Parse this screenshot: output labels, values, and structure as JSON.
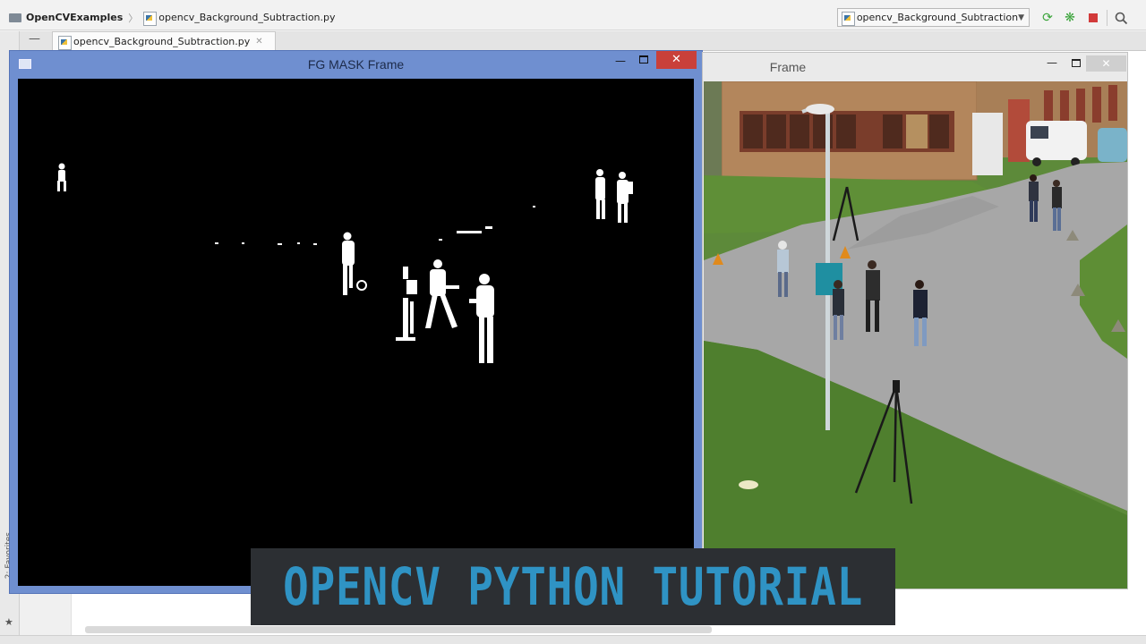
{
  "navbar": {
    "project": "OpenCVExamples",
    "file": "opencv_Background_Subtraction.py",
    "run_config": "opencv_Background_Subtraction",
    "icons": [
      "folder-icon",
      "python-file-icon",
      "rerun-icon",
      "debug-icon",
      "stop-icon",
      "search-icon"
    ]
  },
  "tabs": [
    {
      "label": "opencv_Background_Subtraction.py"
    }
  ],
  "left_strip": {
    "favorites": "2: Favorites"
  },
  "windows": {
    "mask": {
      "title": "FG MASK Frame"
    },
    "frame": {
      "title": "Frame"
    }
  },
  "banner": {
    "text": "OPENCV PYTHON TUTORIAL"
  },
  "colors": {
    "mask_titlebar": "#6f8fd0",
    "close_red": "#c9403a",
    "banner_bg": "#2c2f33",
    "banner_text": "#2f93c4",
    "run_green": "#3aa43a",
    "stop_red": "#d23a3a"
  }
}
